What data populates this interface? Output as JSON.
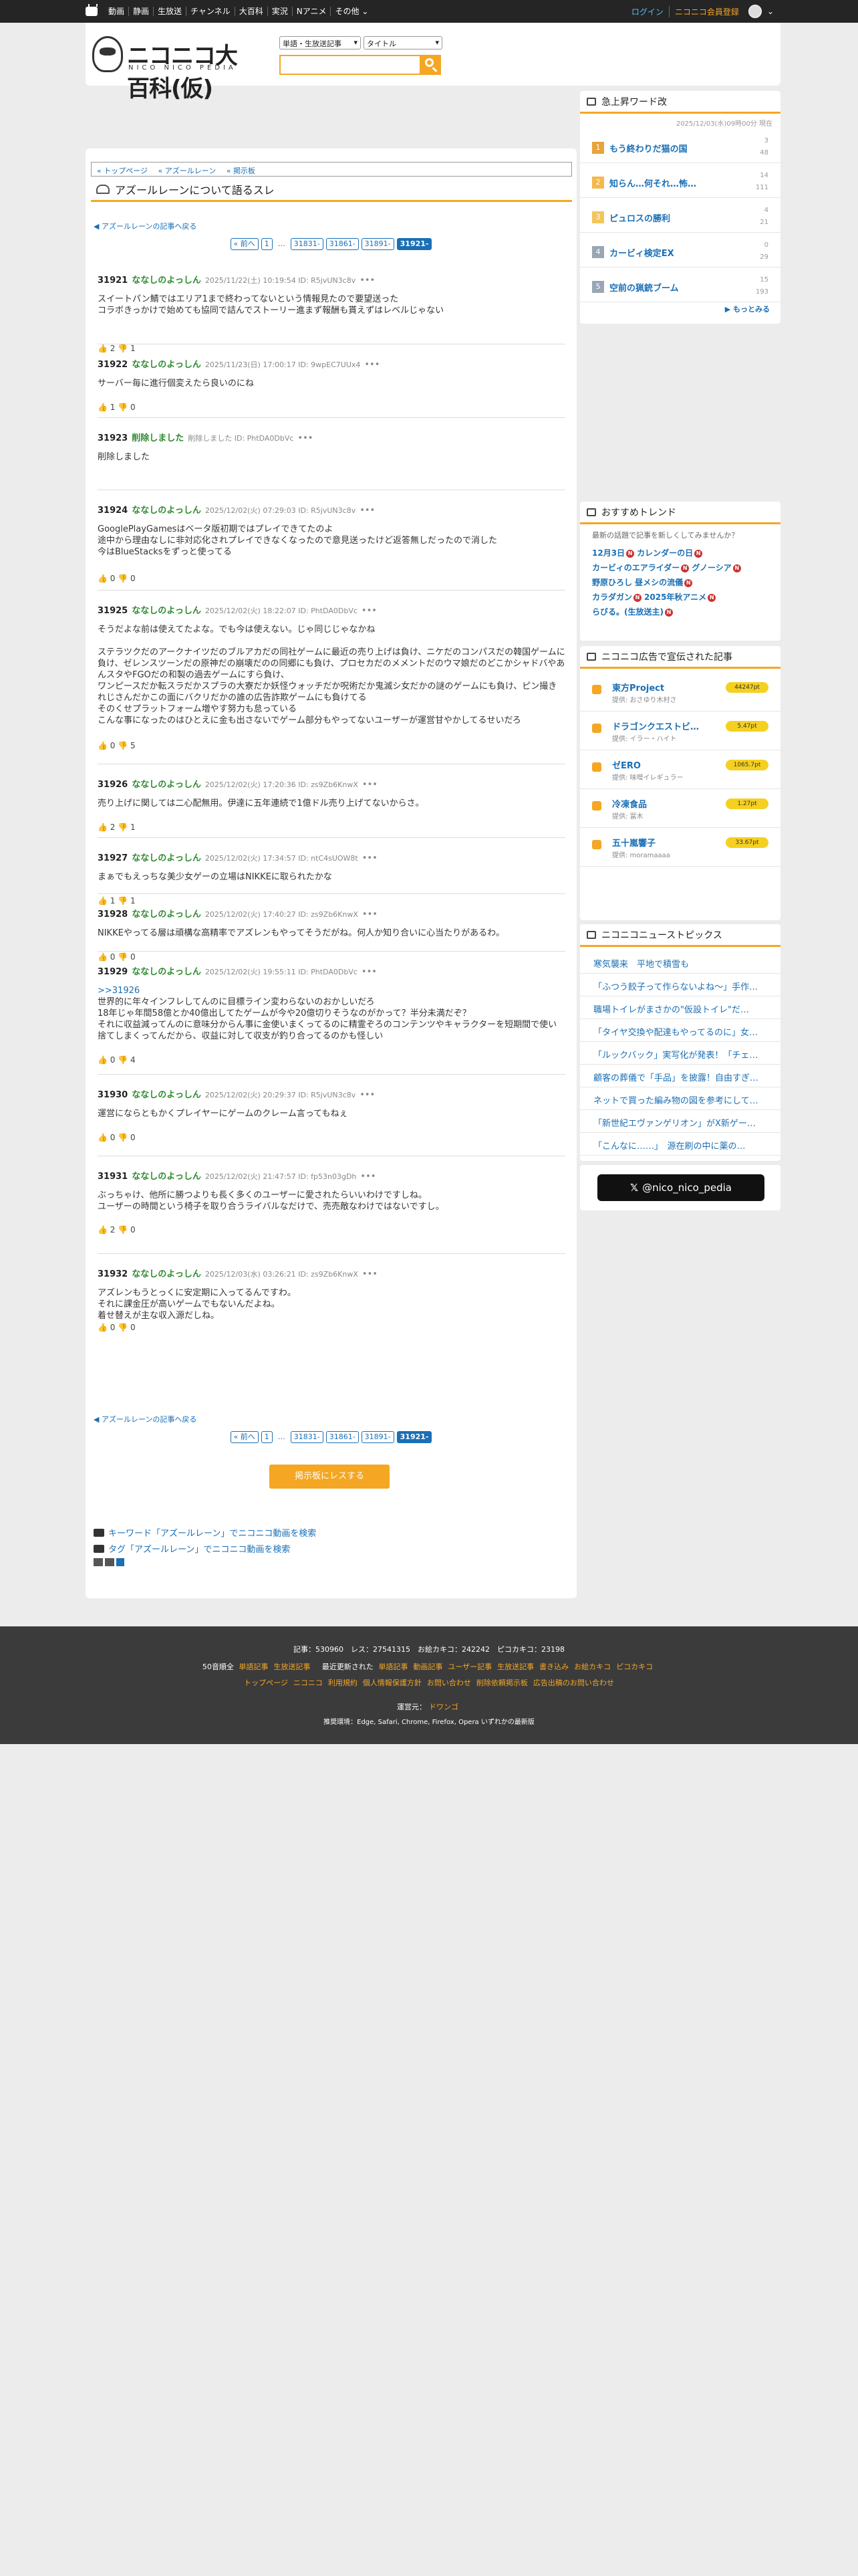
{
  "topbar": {
    "links": [
      "動画",
      "静画",
      "生放送",
      "チャンネル",
      "大百科",
      "実況",
      "Nアニメ",
      "その他"
    ],
    "login": "ログイン",
    "register": "ニコニコ会員登録"
  },
  "header": {
    "logo_text": "ニコニコ大百科(仮)",
    "logo_sub": "NICO NICO PEDIA",
    "select_category": "単語・生放送記事",
    "select_field": "タイトル"
  },
  "breadcrumb": [
    "トップページ",
    "アズールレーン",
    "掲示板"
  ],
  "thread": {
    "title": "アズールレーンについて語るスレ",
    "back_link": "アズールレーンの記事へ戻る",
    "reply_button": "掲示板にレスする"
  },
  "pager": {
    "prev": "« 前へ",
    "first": "1",
    "dots": "…",
    "pages": [
      "31831-",
      "31861-",
      "31891-",
      "31921-"
    ],
    "current": "31921-"
  },
  "posts": [
    {
      "no": "31921",
      "name": "ななしのよっしん",
      "meta": "2025/11/22(土) 10:19:54 ID: R5jvUN3c8v",
      "more": "•••",
      "body": [
        "スイートパン鯖ではエリア1まで終わってないという情報見たので要望送った",
        "コラボきっかけで始めても協同で詰んでストーリー進まず報酬も貰えずはレベルじゃない"
      ],
      "vote": "👍 2  👎 1"
    },
    {
      "no": "31922",
      "name": "ななしのよっしん",
      "meta": "2025/11/23(日) 17:00:17 ID: 9wpEC7UUx4",
      "more": "•••",
      "body": [
        "サーバー毎に進行個変えたら良いのにね"
      ],
      "vote": "👍 1  👎 0"
    },
    {
      "no": "31923",
      "name": "削除しました",
      "meta": "削除しました ID: PhtDA0DbVc",
      "more": "•••",
      "body": [
        "削除しました"
      ],
      "vote": ""
    },
    {
      "no": "31924",
      "name": "ななしのよっしん",
      "meta": "2025/12/02(火) 07:29:03 ID: R5jvUN3c8v",
      "more": "•••",
      "body": [
        "GooglePlayGamesはベータ版初期ではプレイできてたのよ",
        "途中から理由なしに非対応化されプレイできなくなったので意見送ったけど返答無しだったので消した",
        "今はBlueStacksをずっと使ってる"
      ],
      "vote": "👍 0  👎 0"
    },
    {
      "no": "31925",
      "name": "ななしのよっしん",
      "meta": "2025/12/02(火) 18:22:07 ID: PhtDA0DbVc",
      "more": "•••",
      "body": [
        "そうだよな前は使えてたよな。でも今は使えない。じゃ同じじゃなかね",
        "",
        "ステラツクだのアークナイツだのブルアカだの同社ゲームに最近の売り上げは負け、ニケだのコンパスだの韓国ゲームに負け、ゼレンスツーンだの原神だの崩壊だのの同郷にも負け、プロセカだのメメントだのウマ娘だのどこかシャドバやあんスタやFGOだの和製の過去ゲームにすら負け、",
        "ワンピースだか転スラだかスプラの大寮だか妖怪ウォッチだか呪術だか鬼滅シ女だかの謎のゲームにも負け、ピン撮きれじさんだかこの面にバクリだかの誰の広告詐欺ゲームにも負けてる",
        "そのくせプラットフォーム増やす努力も怠っている",
        "こんな事になったのはひとえに金も出さないでゲーム部分もやってないユーザーが運営甘やかしてるせいだろ"
      ],
      "vote": "👍 0  👎 5"
    },
    {
      "no": "31926",
      "name": "ななしのよっしん",
      "meta": "2025/12/02(火) 17:20:36 ID: zs9Zb6KnwX",
      "more": "•••",
      "body": [
        "売り上げに関しては二心配無用。伊達に五年連続で1億ドル売り上げてないからさ。"
      ],
      "vote": "👍 2  👎 1"
    },
    {
      "no": "31927",
      "name": "ななしのよっしん",
      "meta": "2025/12/02(火) 17:34:57 ID: ntC4sUOW8t",
      "more": "•••",
      "body": [
        "まぁでもえっちな美少女ゲーの立場はNIKKEに取られたかな"
      ],
      "vote": "👍 1  👎 1"
    },
    {
      "no": "31928",
      "name": "ななしのよっしん",
      "meta": "2025/12/02(火) 17:40:27 ID: zs9Zb6KnwX",
      "more": "•••",
      "body": [
        "NIKKEやってる層は頑構な高精率でアズレンもやってそうだがね。何人か知り合いに心当たりがあるわ。"
      ],
      "vote": "👍 0  👎 0"
    },
    {
      "no": "31929",
      "name": "ななしのよっしん",
      "meta": "2025/12/02(火) 19:55:11 ID: PhtDA0DbVc",
      "more": "•••",
      "body": [
        ">>31926",
        "世界的に年々インフレしてんのに目標ライン変わらないのおかしいだろ",
        "18年じゃ年間58億とか40億出してたゲームが今や20億切りそうなのがかって？半分未満だぞ？",
        "それに収益減ってんのに意味分からん事に金使いまくってるのに精霊ぞろのコンテンツやキャラクターを短期間で使い捨てしまくってんだから、収益に対して収支が釣り合ってるのかも怪しい"
      ],
      "vote": "👍 0  👎 4"
    },
    {
      "no": "31930",
      "name": "ななしのよっしん",
      "meta": "2025/12/02(火) 20:29:37 ID: R5jvUN3c8v",
      "more": "•••",
      "body": [
        "運営にならともかくプレイヤーにゲームのクレーム言ってもねぇ"
      ],
      "vote": "👍 0  👎 0"
    },
    {
      "no": "31931",
      "name": "ななしのよっしん",
      "meta": "2025/12/02(火) 21:47:57 ID: fp53n03gDh",
      "more": "•••",
      "body": [
        "ぶっちゃけ、他所に勝つよりも長く多くのユーザーに愛されたらいいわけですしね。",
        "ユーザーの時間という椅子を取り合うライバルなだけで、売売敵なわけではないですし。"
      ],
      "vote": "👍 2  👎 0"
    },
    {
      "no": "31932",
      "name": "ななしのよっしん",
      "meta": "2025/12/03(水) 03:26:21 ID: zs9Zb6KnwX",
      "more": "•••",
      "body": [
        "アズレンもうとっくに安定期に入ってるんですわ。",
        "それに課金圧が高いゲームでもないんだよね。",
        "着せ替えが主な収入源だしね。"
      ],
      "vote": "👍 0  👎 0"
    }
  ],
  "search_links": [
    "キーワード「アズールレーン」でニコニコ動画を検索",
    "タグ「アズールレーン」でニコニコ動画を検索"
  ],
  "sidebar": {
    "ranking": {
      "title": "急上昇ワード改",
      "date": "2025/12/03(水)09時00分 現在",
      "items": [
        {
          "rank": "1",
          "title": "もう終わりだ猫の国",
          "s1": "3",
          "s2": "48",
          "color": "#e8a33a"
        },
        {
          "rank": "2",
          "title": "知らん…何それ…怖…",
          "s1": "14",
          "s2": "111",
          "color": "#f5b84a"
        },
        {
          "rank": "3",
          "title": "ピュロスの勝利",
          "s1": "4",
          "s2": "21",
          "color": "#f5c55c"
        },
        {
          "rank": "4",
          "title": "カービィ検定EX",
          "s1": "0",
          "s2": "29",
          "color": "#9aa6b5"
        },
        {
          "rank": "5",
          "title": "空前の猟銃ブーム",
          "s1": "15",
          "s2": "193",
          "color": "#9aa6b5"
        }
      ],
      "more": "もっとみる"
    },
    "trend": {
      "title": "おすすめトレンド",
      "hint": "最新の話題で記事を新しくしてみませんか？",
      "lines": [
        [
          "12月3日",
          "カレンダーの日"
        ],
        [
          "カービィのエアライダー",
          "グノーシア"
        ],
        [
          "野原ひろし 昼メシの流儀"
        ],
        [
          "カラダガン",
          "2025年秋アニメ"
        ],
        [
          "らびる。(生放送主)"
        ]
      ]
    },
    "ads": {
      "title": "ニコニコ広告で宣伝された記事",
      "items": [
        {
          "title": "東方Project",
          "by": "提供: おさゆり木村さ",
          "pt": "44247pt"
        },
        {
          "title": "ドラゴンクエストビ…",
          "by": "提供: イラー・ハイト",
          "pt": "5.47pt"
        },
        {
          "title": "ゼERO",
          "by": "提供: 味噌イレギュラー",
          "pt": "1065.7pt"
        },
        {
          "title": "冷凍食品",
          "by": "提供: 冨木",
          "pt": "1.27pt"
        },
        {
          "title": "五十嵐響子",
          "by": "提供: moramaaaa",
          "pt": "33.67pt"
        }
      ]
    },
    "news": {
      "title": "ニコニコニューストピックス",
      "items": [
        "寒気襲来　平地で積雪も",
        "「ふつう餃子って作らないよね～」手作…",
        "職場トイレがまさかの\"仮設トイレ\"だ…",
        "「タイヤ交換や配達もやってるのに」女…",
        "「ルックバック」実写化が発表！「チェ…",
        "顧客の葬儀で「手品」を披露！自由すぎ…",
        "ネットで買った編み物の図を参考にして…",
        "「新世紀エヴァンゲリオン」がX新ゲー…",
        "「こんなに……」　源在刷の中に薬の…"
      ]
    },
    "x_button": "@nico_nico_pedia"
  },
  "footer": {
    "stats": "記事：530960　レス：27541315　お絵カキコ：242242　ピコカキコ：23198",
    "row2_label1": "50音順全",
    "row2_links1": [
      "単語記事",
      "生放送記事"
    ],
    "row2_label2": "最近更新された",
    "row2_links2": [
      "単語記事",
      "動画記事",
      "ユーザー記事",
      "生放送記事",
      "書き込み",
      "お絵カキコ",
      "ピコカキコ"
    ],
    "row3_links": [
      "トップページ",
      "ニコニコ",
      "利用規約",
      "個人情報保護方針",
      "お問い合わせ",
      "削除依頼掲示板",
      "広告出稿のお問い合わせ"
    ],
    "operator_label": "運営元：",
    "operator": "ドワンゴ",
    "browsers": "推奨環境：Edge, Safari, Chrome, Firefox, Opera いずれかの最新版"
  },
  "colors": {
    "accent": "#f5a623",
    "link": "#1a6fb5",
    "name": "#2e8b2e",
    "topbar": "#252525",
    "footer": "#3b3b3b"
  }
}
